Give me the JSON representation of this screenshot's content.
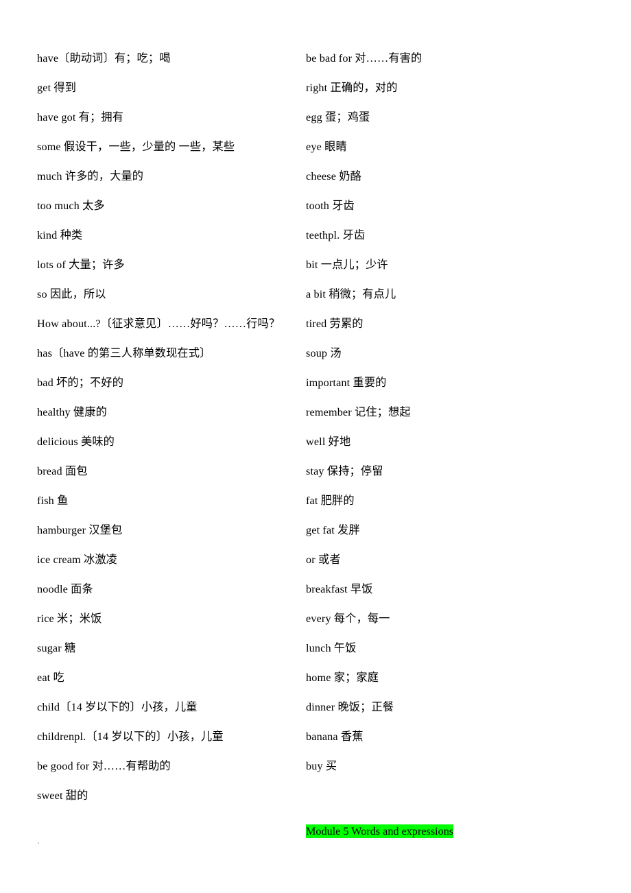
{
  "document": {
    "type": "vocabulary-list",
    "language_pair": "English-Chinese",
    "highlight_color": "#00ff00",
    "text_color": "#000000",
    "background_color": "#ffffff"
  },
  "left_column": {
    "entries": [
      "have〔助动词〕有；吃；喝",
      "get 得到",
      "have got 有；拥有",
      "some 假设干，一些，少量的 一些，某些",
      "much 许多的，大量的",
      "too much 太多",
      "kind 种类",
      "lots of 大量；许多",
      "so 因此，所以",
      "How about...?〔征求意见〕……好吗？……行吗？",
      "has〔have 的第三人称单数现在式〕",
      "bad 坏的；不好的",
      "healthy 健康的",
      "delicious 美味的",
      "bread 面包",
      "fish 鱼",
      "hamburger 汉堡包",
      "ice cream 冰激凌",
      "noodle 面条",
      "rice 米；米饭",
      "sugar 糖",
      "eat 吃",
      "child〔14 岁以下的〕小孩，儿童",
      "childrenpl.〔14 岁以下的〕小孩，儿童",
      "be good for 对……有帮助的",
      "sweet 甜的"
    ]
  },
  "right_column": {
    "entries": [
      "be bad for 对……有害的",
      "right 正确的，对的",
      "egg 蛋；鸡蛋",
      "eye 眼睛",
      "cheese 奶酪",
      "tooth 牙齿",
      "teethpl. 牙齿",
      "bit 一点儿；少许",
      "a bit 稍微；有点儿",
      "tired 劳累的",
      "soup 汤",
      "important 重要的",
      "remember 记住；想起",
      "well 好地",
      "stay 保持；停留",
      "fat 肥胖的",
      "get fat 发胖",
      "or 或者",
      "breakfast 早饭",
      "every 每个，每一",
      "lunch 午饭",
      "home 家；家庭",
      "dinner 晚饭；正餐",
      "banana 香蕉",
      "buy 买"
    ],
    "section_heading": "Module 5 Words and expressions"
  }
}
